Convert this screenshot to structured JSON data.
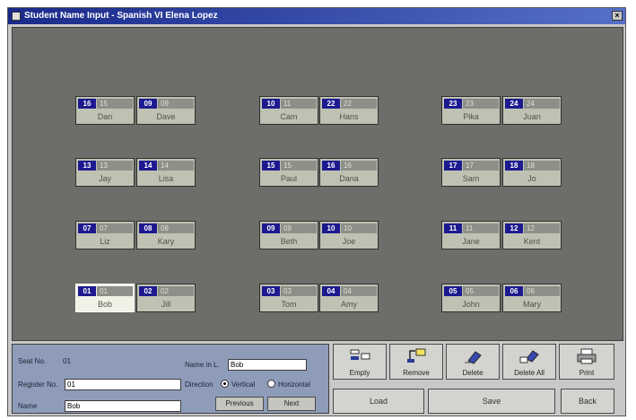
{
  "window": {
    "title": "Student Name Input - Spanish VI Elena Lopez",
    "close_glyph": "×"
  },
  "seats": [
    {
      "num": "16",
      "sub": "15",
      "name": "Dan"
    },
    {
      "num": "09",
      "sub": "09",
      "name": "Dave"
    },
    {
      "num": "10",
      "sub": "11",
      "name": "Cam"
    },
    {
      "num": "22",
      "sub": "22",
      "name": "Hans"
    },
    {
      "num": "23",
      "sub": "23",
      "name": "Pika"
    },
    {
      "num": "24",
      "sub": "24",
      "name": "Juan"
    },
    {
      "num": "13",
      "sub": "13",
      "name": "Jay"
    },
    {
      "num": "14",
      "sub": "14",
      "name": "Lisa"
    },
    {
      "num": "15",
      "sub": "15",
      "name": "Paul"
    },
    {
      "num": "16",
      "sub": "16",
      "name": "Dana"
    },
    {
      "num": "17",
      "sub": "17",
      "name": "Sam"
    },
    {
      "num": "18",
      "sub": "18",
      "name": "Jo"
    },
    {
      "num": "07",
      "sub": "07",
      "name": "Liz"
    },
    {
      "num": "08",
      "sub": "08",
      "name": "Kary"
    },
    {
      "num": "09",
      "sub": "09",
      "name": "Beth"
    },
    {
      "num": "10",
      "sub": "10",
      "name": "Joe"
    },
    {
      "num": "11",
      "sub": "11",
      "name": "Jane"
    },
    {
      "num": "12",
      "sub": "12",
      "name": "Kent"
    },
    {
      "num": "01",
      "sub": "01",
      "name": "Bob",
      "selected": true
    },
    {
      "num": "02",
      "sub": "02",
      "name": "Jill"
    },
    {
      "num": "03",
      "sub": "03",
      "name": "Tom"
    },
    {
      "num": "04",
      "sub": "04",
      "name": "Amy"
    },
    {
      "num": "05",
      "sub": "05",
      "name": "John"
    },
    {
      "num": "06",
      "sub": "06",
      "name": "Mary"
    }
  ],
  "panel": {
    "seat_no_label": "Seat No.",
    "seat_no_value": "01",
    "register_no_label": "Register No.",
    "register_no_value": "01",
    "name_label": "Name",
    "name_value": "Bob",
    "name_in_l_label": "Name in L.",
    "name_in_l_value": "Bob",
    "direction_label": "Direction",
    "vertical_label": "Vertical",
    "horizontal_label": "Horizontal",
    "direction_selected": "vertical",
    "previous_label": "Previous",
    "next_label": "Next"
  },
  "tools": [
    {
      "label": "Empty",
      "icon": "empty-seat-icon"
    },
    {
      "label": "Remove",
      "icon": "remove-seat-icon"
    },
    {
      "label": "Delete",
      "icon": "eraser-icon"
    },
    {
      "label": "Delete All",
      "icon": "eraser-all-icon"
    },
    {
      "label": "Print",
      "icon": "printer-icon"
    }
  ],
  "actions": {
    "load_label": "Load",
    "save_label": "Save",
    "back_label": "Back"
  },
  "colors": {
    "room": "#6d6e69",
    "seat": "#bfc2b3",
    "seat_number": "#1d1a8f",
    "panel": "#8e9cba",
    "titlebar": "#1a2a8a"
  }
}
